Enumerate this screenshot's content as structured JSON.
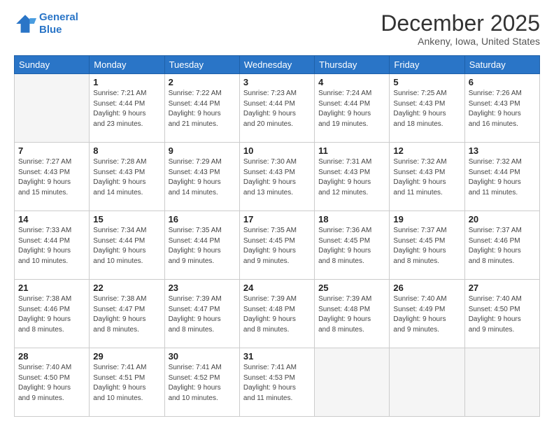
{
  "logo": {
    "line1": "General",
    "line2": "Blue"
  },
  "header": {
    "month": "December 2025",
    "location": "Ankeny, Iowa, United States"
  },
  "days_of_week": [
    "Sunday",
    "Monday",
    "Tuesday",
    "Wednesday",
    "Thursday",
    "Friday",
    "Saturday"
  ],
  "weeks": [
    [
      {
        "day": "",
        "empty": true
      },
      {
        "day": "1",
        "sunrise": "7:21 AM",
        "sunset": "4:44 PM",
        "daylight": "9 hours and 23 minutes."
      },
      {
        "day": "2",
        "sunrise": "7:22 AM",
        "sunset": "4:44 PM",
        "daylight": "9 hours and 21 minutes."
      },
      {
        "day": "3",
        "sunrise": "7:23 AM",
        "sunset": "4:44 PM",
        "daylight": "9 hours and 20 minutes."
      },
      {
        "day": "4",
        "sunrise": "7:24 AM",
        "sunset": "4:44 PM",
        "daylight": "9 hours and 19 minutes."
      },
      {
        "day": "5",
        "sunrise": "7:25 AM",
        "sunset": "4:43 PM",
        "daylight": "9 hours and 18 minutes."
      },
      {
        "day": "6",
        "sunrise": "7:26 AM",
        "sunset": "4:43 PM",
        "daylight": "9 hours and 16 minutes."
      }
    ],
    [
      {
        "day": "7",
        "sunrise": "7:27 AM",
        "sunset": "4:43 PM",
        "daylight": "9 hours and 15 minutes."
      },
      {
        "day": "8",
        "sunrise": "7:28 AM",
        "sunset": "4:43 PM",
        "daylight": "9 hours and 14 minutes."
      },
      {
        "day": "9",
        "sunrise": "7:29 AM",
        "sunset": "4:43 PM",
        "daylight": "9 hours and 14 minutes."
      },
      {
        "day": "10",
        "sunrise": "7:30 AM",
        "sunset": "4:43 PM",
        "daylight": "9 hours and 13 minutes."
      },
      {
        "day": "11",
        "sunrise": "7:31 AM",
        "sunset": "4:43 PM",
        "daylight": "9 hours and 12 minutes."
      },
      {
        "day": "12",
        "sunrise": "7:32 AM",
        "sunset": "4:43 PM",
        "daylight": "9 hours and 11 minutes."
      },
      {
        "day": "13",
        "sunrise": "7:32 AM",
        "sunset": "4:44 PM",
        "daylight": "9 hours and 11 minutes."
      }
    ],
    [
      {
        "day": "14",
        "sunrise": "7:33 AM",
        "sunset": "4:44 PM",
        "daylight": "9 hours and 10 minutes."
      },
      {
        "day": "15",
        "sunrise": "7:34 AM",
        "sunset": "4:44 PM",
        "daylight": "9 hours and 10 minutes."
      },
      {
        "day": "16",
        "sunrise": "7:35 AM",
        "sunset": "4:44 PM",
        "daylight": "9 hours and 9 minutes."
      },
      {
        "day": "17",
        "sunrise": "7:35 AM",
        "sunset": "4:45 PM",
        "daylight": "9 hours and 9 minutes."
      },
      {
        "day": "18",
        "sunrise": "7:36 AM",
        "sunset": "4:45 PM",
        "daylight": "9 hours and 8 minutes."
      },
      {
        "day": "19",
        "sunrise": "7:37 AM",
        "sunset": "4:45 PM",
        "daylight": "9 hours and 8 minutes."
      },
      {
        "day": "20",
        "sunrise": "7:37 AM",
        "sunset": "4:46 PM",
        "daylight": "9 hours and 8 minutes."
      }
    ],
    [
      {
        "day": "21",
        "sunrise": "7:38 AM",
        "sunset": "4:46 PM",
        "daylight": "9 hours and 8 minutes."
      },
      {
        "day": "22",
        "sunrise": "7:38 AM",
        "sunset": "4:47 PM",
        "daylight": "9 hours and 8 minutes."
      },
      {
        "day": "23",
        "sunrise": "7:39 AM",
        "sunset": "4:47 PM",
        "daylight": "9 hours and 8 minutes."
      },
      {
        "day": "24",
        "sunrise": "7:39 AM",
        "sunset": "4:48 PM",
        "daylight": "9 hours and 8 minutes."
      },
      {
        "day": "25",
        "sunrise": "7:39 AM",
        "sunset": "4:48 PM",
        "daylight": "9 hours and 8 minutes."
      },
      {
        "day": "26",
        "sunrise": "7:40 AM",
        "sunset": "4:49 PM",
        "daylight": "9 hours and 9 minutes."
      },
      {
        "day": "27",
        "sunrise": "7:40 AM",
        "sunset": "4:50 PM",
        "daylight": "9 hours and 9 minutes."
      }
    ],
    [
      {
        "day": "28",
        "sunrise": "7:40 AM",
        "sunset": "4:50 PM",
        "daylight": "9 hours and 9 minutes."
      },
      {
        "day": "29",
        "sunrise": "7:41 AM",
        "sunset": "4:51 PM",
        "daylight": "9 hours and 10 minutes."
      },
      {
        "day": "30",
        "sunrise": "7:41 AM",
        "sunset": "4:52 PM",
        "daylight": "9 hours and 10 minutes."
      },
      {
        "day": "31",
        "sunrise": "7:41 AM",
        "sunset": "4:53 PM",
        "daylight": "9 hours and 11 minutes."
      },
      {
        "day": "",
        "empty": true
      },
      {
        "day": "",
        "empty": true
      },
      {
        "day": "",
        "empty": true
      }
    ]
  ]
}
